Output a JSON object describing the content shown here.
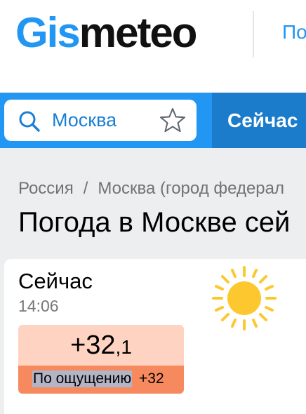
{
  "header": {
    "logo_part1": "Gis",
    "logo_part2": "meteo",
    "link_text": "По"
  },
  "search": {
    "value": "Москва",
    "placeholder": "Москва",
    "now_tab": "Сейчас"
  },
  "breadcrumb": {
    "item1": "Россия",
    "separator": "/",
    "item2": "Москва (город федерал"
  },
  "page_title": "Погода в Москве сей",
  "current": {
    "title": "Сейчас",
    "time": "14:06",
    "temp_integer": "+32",
    "temp_decimal": ",1",
    "feels_label": "По ощущению",
    "feels_value": "+32"
  },
  "icons": {
    "search": "search-icon",
    "star": "star-icon",
    "weather": "sun-icon"
  },
  "colors": {
    "brand_blue": "#2196f3",
    "tab_blue": "#1a7ccb",
    "sun": "#fdc82f",
    "temp_bg": "#ffd3c1",
    "feels_bg": "#f7895f"
  }
}
